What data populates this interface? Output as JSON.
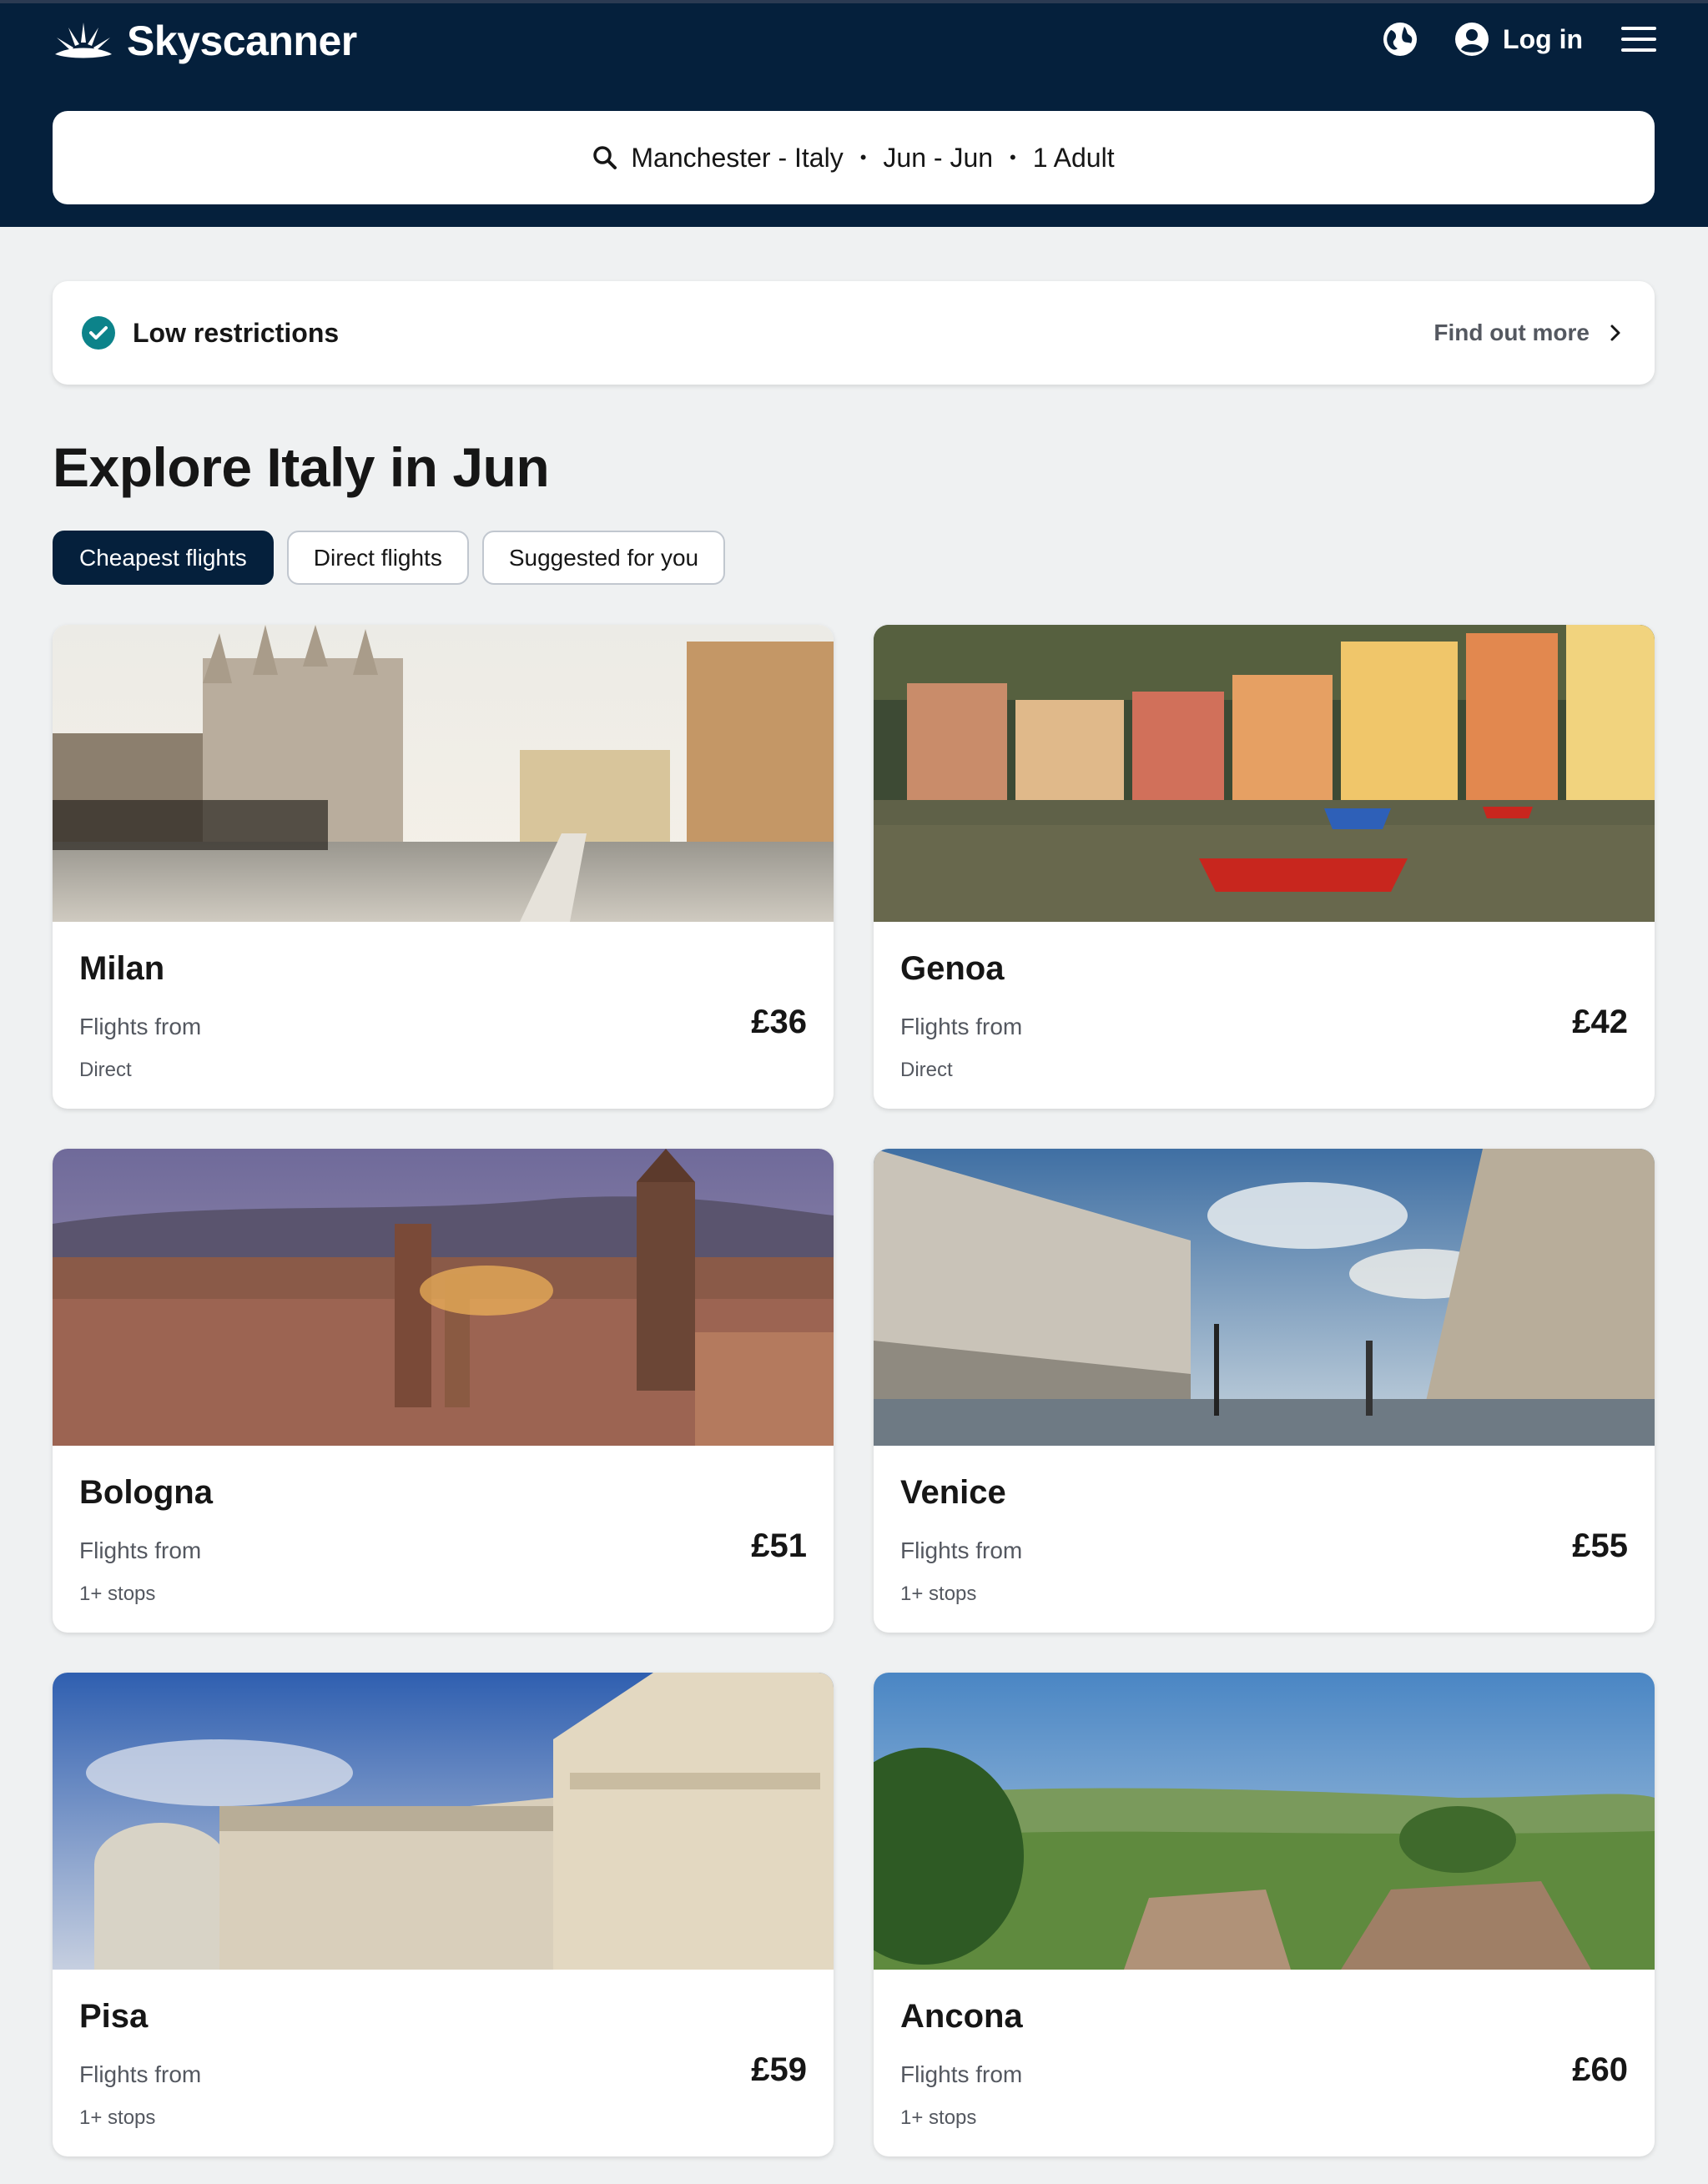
{
  "header": {
    "brand": "Skyscanner",
    "login_label": "Log in"
  },
  "search": {
    "route": "Manchester - Italy",
    "dates": "Jun - Jun",
    "travellers": "1 Adult",
    "separator": "•"
  },
  "banner": {
    "title": "Low restrictions",
    "link": "Find out more"
  },
  "explore": {
    "title": "Explore Italy in Jun",
    "chips": [
      "Cheapest flights",
      "Direct flights",
      "Suggested for you"
    ],
    "active_chip": "Cheapest flights"
  },
  "cards": [
    {
      "city": "Milan",
      "from_label": "Flights from",
      "price": "£36",
      "stops": "Direct"
    },
    {
      "city": "Genoa",
      "from_label": "Flights from",
      "price": "£42",
      "stops": "Direct"
    },
    {
      "city": "Bologna",
      "from_label": "Flights from",
      "price": "£51",
      "stops": "1+ stops"
    },
    {
      "city": "Venice",
      "from_label": "Flights from",
      "price": "£55",
      "stops": "1+ stops"
    },
    {
      "city": "Pisa",
      "from_label": "Flights from",
      "price": "£59",
      "stops": "1+ stops"
    },
    {
      "city": "Ancona",
      "from_label": "Flights from",
      "price": "£60",
      "stops": "1+ stops"
    }
  ],
  "colors": {
    "header_bg": "#05203c",
    "page_bg": "#eff1f2",
    "check_green": "#0c838a",
    "active_chip": "#05203c"
  },
  "icons": {
    "logo": "skyscanner-sunburst-icon",
    "globe": "globe-icon",
    "user": "user-circle-icon",
    "menu": "hamburger-menu-icon",
    "search": "search-icon",
    "check": "check-circle-icon",
    "chevron": "chevron-right-icon"
  }
}
